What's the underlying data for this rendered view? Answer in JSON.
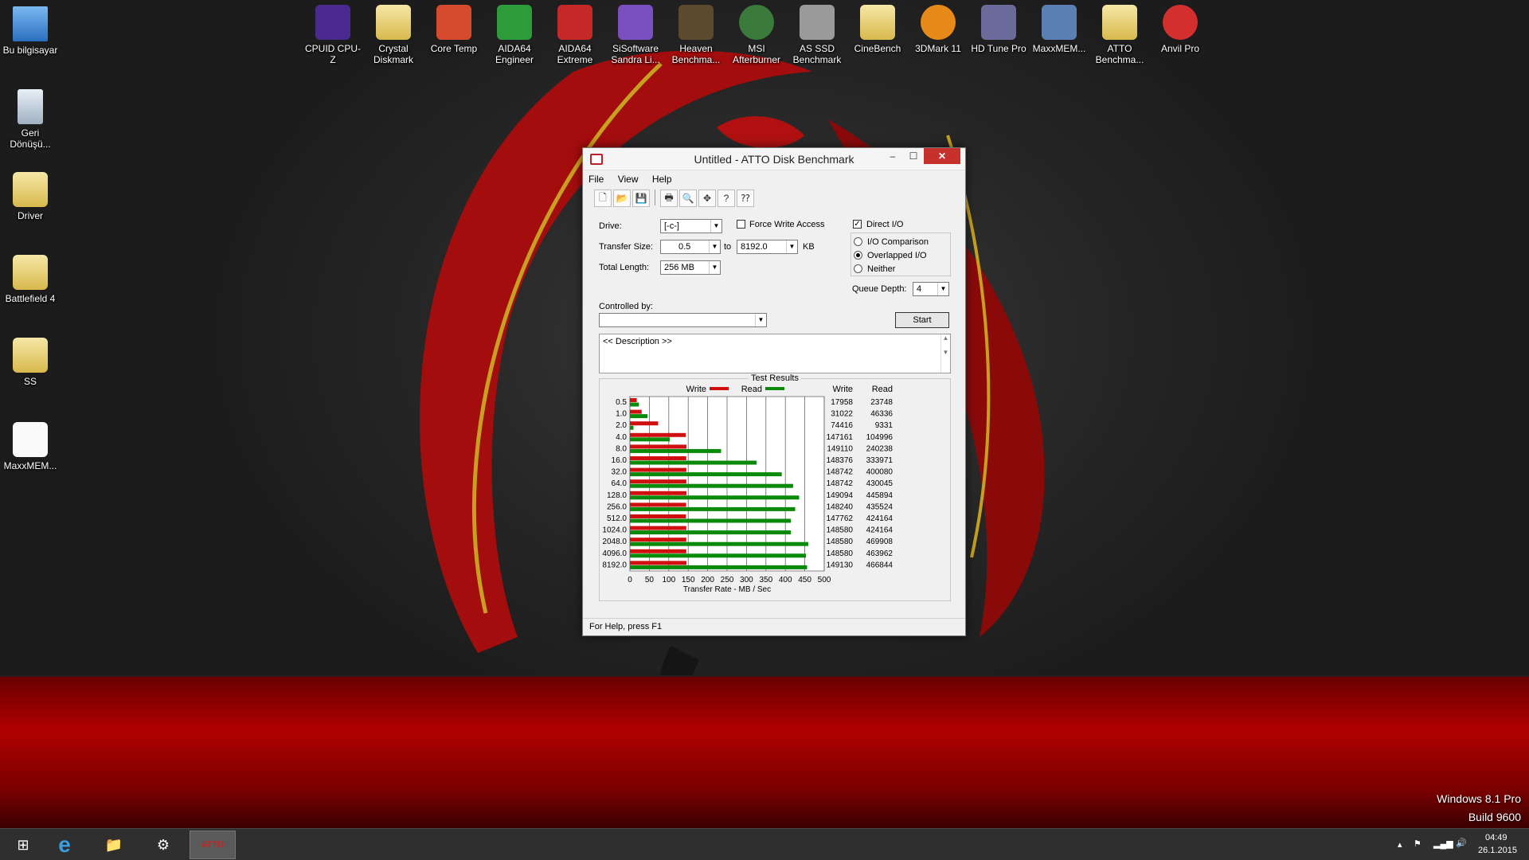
{
  "desktop_left_icons": [
    {
      "label": "Bu bilgisayar",
      "icon": "computer-icon"
    },
    {
      "label": "Geri Dönüşü...",
      "icon": "recycle-bin-icon"
    },
    {
      "label": "Driver",
      "icon": "folder-icon"
    },
    {
      "label": "Battlefield 4",
      "icon": "folder-icon"
    },
    {
      "label": "SS",
      "icon": "folder-icon"
    },
    {
      "label": "MaxxMEM...",
      "icon": "document-icon"
    }
  ],
  "desktop_top_icons": [
    {
      "label": "CPUID CPU-Z",
      "icon": "cpuz-icon",
      "color": "#4b2a8f"
    },
    {
      "label": "Crystal Diskmark",
      "icon": "folder-icon",
      "color": "#d8b94d"
    },
    {
      "label": "Core Temp",
      "icon": "thermometer-icon",
      "color": "#d64a2e"
    },
    {
      "label": "AIDA64 Engineer",
      "icon": "aida64-engineer-icon",
      "color": "#2e9b3a"
    },
    {
      "label": "AIDA64 Extreme",
      "icon": "aida64-extreme-icon",
      "color": "#c62828"
    },
    {
      "label": "SiSoftware Sandra Li...",
      "icon": "sandra-icon",
      "color": "#7b4fbf"
    },
    {
      "label": "Heaven Benchma...",
      "icon": "heaven-icon",
      "color": "#5b4a2e"
    },
    {
      "label": "MSI Afterburner",
      "icon": "afterburner-icon",
      "color": "#3a7a3a"
    },
    {
      "label": "AS SSD Benchmark",
      "icon": "ssd-icon",
      "color": "#9a9a9a"
    },
    {
      "label": "CineBench",
      "icon": "folder-icon",
      "color": "#d8b94d"
    },
    {
      "label": "3DMark 11",
      "icon": "3dmark-icon",
      "color": "#e88a1a"
    },
    {
      "label": "HD Tune Pro",
      "icon": "hdtune-icon",
      "color": "#6b6b9b"
    },
    {
      "label": "MaxxMEM...",
      "icon": "gear-icon",
      "color": "#5c7fb3"
    },
    {
      "label": "ATTO Benchma...",
      "icon": "folder-icon",
      "color": "#d8b94d"
    },
    {
      "label": "Anvil Pro",
      "icon": "anvil-icon",
      "color": "#d32f2f"
    }
  ],
  "window": {
    "title": "Untitled - ATTO Disk Benchmark",
    "minimize": "–",
    "maximize": "☐",
    "close": "✕",
    "menu": [
      "File",
      "View",
      "Help"
    ],
    "toolbar_icons": [
      "new-icon",
      "open-icon",
      "save-icon",
      "print-icon",
      "print-preview-icon",
      "move-icon",
      "help-icon",
      "context-help-icon"
    ],
    "toolbar_glyphs": [
      "🗋",
      "📂",
      "💾",
      "🖶",
      "🔍",
      "✥",
      "?",
      "⁇"
    ],
    "drive_label": "Drive:",
    "drive_value": "[-c-]",
    "force_write_label": "Force Write Access",
    "force_write_checked": false,
    "direct_io_label": "Direct I/O",
    "direct_io_checked": true,
    "transfer_size_label": "Transfer Size:",
    "transfer_from": "0.5",
    "transfer_to_label": "to",
    "transfer_to": "8192.0",
    "transfer_unit": "KB",
    "total_length_label": "Total Length:",
    "total_length_value": "256 MB",
    "io_options": [
      {
        "label": "I/O Comparison",
        "selected": false
      },
      {
        "label": "Overlapped I/O",
        "selected": true
      },
      {
        "label": "Neither",
        "selected": false
      }
    ],
    "queue_depth_label": "Queue Depth:",
    "queue_depth_value": "4",
    "controlled_by_label": "Controlled by:",
    "controlled_by_value": "",
    "start_button": "Start",
    "description": "<< Description >>",
    "results_title": "Test Results",
    "legend_write": "Write",
    "legend_read": "Read",
    "col_write": "Write",
    "col_read": "Read",
    "status": "For Help, press F1"
  },
  "chart_data": {
    "type": "bar",
    "orientation": "horizontal",
    "categories": [
      "0.5",
      "1.0",
      "2.0",
      "4.0",
      "8.0",
      "16.0",
      "32.0",
      "64.0",
      "128.0",
      "256.0",
      "512.0",
      "1024.0",
      "2048.0",
      "4096.0",
      "8192.0"
    ],
    "series": [
      {
        "name": "Write",
        "color": "#d01010",
        "values": [
          17958,
          31022,
          74416,
          147161,
          149110,
          148376,
          148742,
          148742,
          149094,
          148240,
          147762,
          148580,
          148580,
          148580,
          149130
        ]
      },
      {
        "name": "Read",
        "color": "#0a8a0a",
        "values": [
          23748,
          46336,
          9331,
          104996,
          240238,
          333971,
          400080,
          430045,
          445894,
          435524,
          424164,
          424164,
          469908,
          463962,
          466844
        ]
      }
    ],
    "x_ticks": [
      "0",
      "50",
      "100",
      "150",
      "200",
      "250",
      "300",
      "350",
      "400",
      "450",
      "500"
    ],
    "xlabel": "Transfer Rate - MB / Sec",
    "xlim": [
      0,
      500
    ]
  },
  "taskbar": {
    "apps": [
      {
        "name": "start-button",
        "glyph": "⊞"
      },
      {
        "name": "internet-explorer",
        "glyph": "e"
      },
      {
        "name": "file-explorer",
        "glyph": "📁"
      },
      {
        "name": "app-pinned",
        "glyph": "⚙"
      },
      {
        "name": "atto-disk-benchmark",
        "glyph": "ATTO"
      }
    ],
    "time": "04:49",
    "date": "26.1.2015"
  },
  "watermark": {
    "line1": "Windows 8.1 Pro",
    "line2": "Build 9600"
  }
}
